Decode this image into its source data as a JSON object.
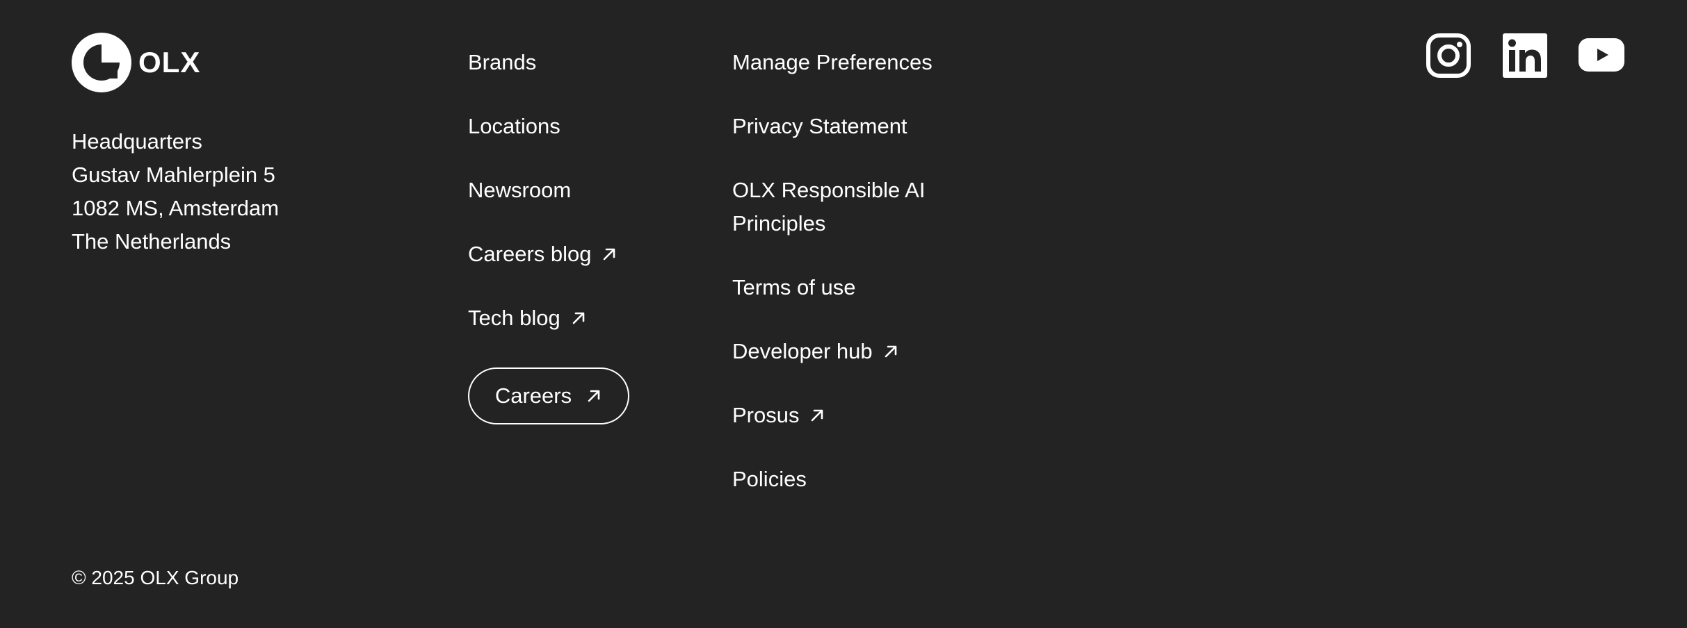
{
  "brand": {
    "logo_text": "OLX"
  },
  "address": {
    "line1": "Headquarters",
    "line2": "Gustav Mahlerplein 5",
    "line3": "1082 MS, Amsterdam",
    "line4": "The Netherlands"
  },
  "nav_col1": {
    "brands": "Brands",
    "locations": "Locations",
    "newsroom": "Newsroom",
    "careers_blog": "Careers blog",
    "tech_blog": "Tech blog",
    "careers_button": "Careers"
  },
  "nav_col2": {
    "manage_preferences": "Manage Preferences",
    "privacy_statement": "Privacy Statement",
    "responsible_ai_line1": "OLX Responsible AI",
    "responsible_ai_line2": "Principles",
    "terms_of_use": "Terms of use",
    "developer_hub": "Developer hub",
    "prosus": "Prosus",
    "policies": "Policies"
  },
  "social": {
    "icons": [
      "instagram-icon",
      "linkedin-icon",
      "youtube-icon"
    ]
  },
  "footer": {
    "copyright": "© 2025 OLX Group"
  },
  "colors": {
    "background": "#232323",
    "text": "#ffffff"
  }
}
